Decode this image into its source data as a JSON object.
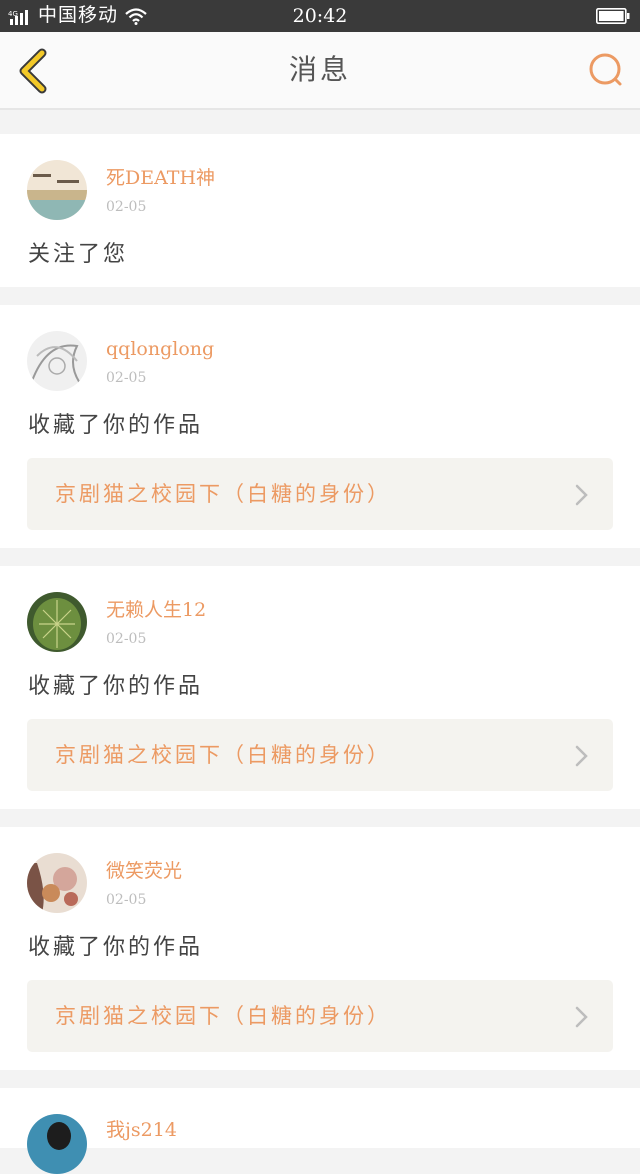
{
  "status_bar": {
    "network": "4G",
    "carrier": "中国移动",
    "time": "20:42"
  },
  "nav": {
    "title": "消息",
    "back_icon": "chevron-left-icon",
    "search_icon": "search-icon",
    "accent_color": "#ec9a63",
    "back_color": "#f3c928"
  },
  "messages": [
    {
      "username": "死DEATH神",
      "date": "02-05",
      "action": "关注了您"
    },
    {
      "username": "qqlonglong",
      "date": "02-05",
      "action": "收藏了你的作品",
      "work_title": "京剧猫之校园下（白糖的身份）"
    },
    {
      "username": "无赖人生12",
      "date": "02-05",
      "action": "收藏了你的作品",
      "work_title": "京剧猫之校园下（白糖的身份）"
    },
    {
      "username": "微笑荧光",
      "date": "02-05",
      "action": "收藏了你的作品",
      "work_title": "京剧猫之校园下（白糖的身份）"
    },
    {
      "username": "我js214"
    }
  ]
}
